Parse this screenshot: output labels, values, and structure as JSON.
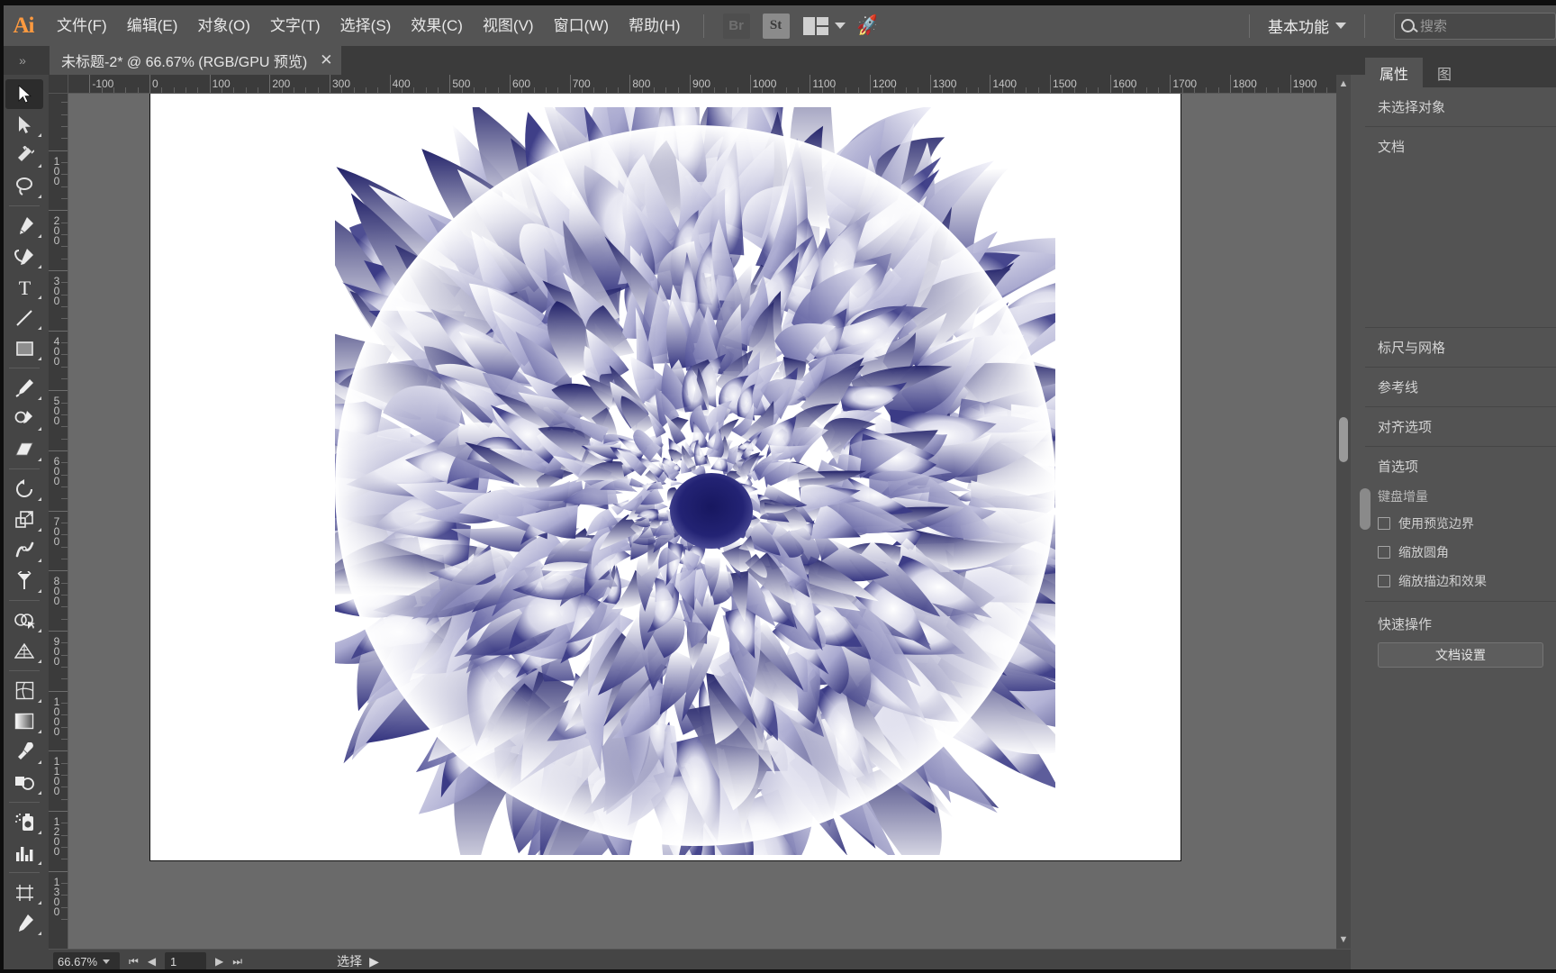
{
  "app": {
    "name": "Adobe Illustrator",
    "logo_text": "Ai",
    "accent_color": "#ff9a3f"
  },
  "menubar": {
    "items": [
      {
        "label": "文件(F)",
        "name": "file"
      },
      {
        "label": "编辑(E)",
        "name": "edit"
      },
      {
        "label": "对象(O)",
        "name": "object"
      },
      {
        "label": "文字(T)",
        "name": "type"
      },
      {
        "label": "选择(S)",
        "name": "select"
      },
      {
        "label": "效果(C)",
        "name": "effect"
      },
      {
        "label": "视图(V)",
        "name": "view"
      },
      {
        "label": "窗口(W)",
        "name": "window"
      },
      {
        "label": "帮助(H)",
        "name": "help"
      }
    ],
    "bridge_label": "Br",
    "stock_label": "St",
    "arrange_icon": "arrange-documents-icon",
    "rocket_icon": "discover-rocket-icon",
    "workspace_label": "基本功能",
    "workspace_chevron": "chevron-down-icon",
    "search_placeholder": "搜索",
    "search_value": "",
    "search_icon": "search-icon"
  },
  "tabbar": {
    "collapse_icon": "double-chevron-right-icon",
    "document_title": "未标题-2* @ 66.67% (RGB/GPU 预览)",
    "close_label": "✕"
  },
  "toolbar": {
    "tools": [
      {
        "name": "selection-tool",
        "label": "选择工具",
        "selected": true
      },
      {
        "name": "direct-selection-tool",
        "label": "直接选择工具",
        "selected": false
      },
      {
        "name": "magic-wand-tool",
        "label": "魔棒工具",
        "selected": false
      },
      {
        "name": "lasso-tool",
        "label": "套索工具",
        "selected": false
      },
      {
        "name": "pen-tool",
        "label": "钢笔工具",
        "selected": false
      },
      {
        "name": "curvature-tool",
        "label": "曲率工具",
        "selected": false
      },
      {
        "name": "type-tool",
        "label": "文字工具",
        "selected": false
      },
      {
        "name": "line-segment-tool",
        "label": "直线段工具",
        "selected": false
      },
      {
        "name": "rectangle-tool",
        "label": "矩形工具",
        "selected": false
      },
      {
        "name": "paintbrush-tool",
        "label": "画笔工具",
        "selected": false
      },
      {
        "name": "pencil-tool",
        "label": "铅笔工具",
        "selected": false
      },
      {
        "name": "eraser-tool",
        "label": "橡皮擦工具",
        "selected": false
      },
      {
        "name": "rotate-tool",
        "label": "旋转工具",
        "selected": false
      },
      {
        "name": "scale-tool",
        "label": "比例缩放工具",
        "selected": false
      },
      {
        "name": "width-tool",
        "label": "宽度工具",
        "selected": false
      },
      {
        "name": "free-transform-tool",
        "label": "自由变换工具",
        "selected": false
      },
      {
        "name": "shape-builder-tool",
        "label": "形状生成器工具",
        "selected": false
      },
      {
        "name": "perspective-grid-tool",
        "label": "透视网格工具",
        "selected": false
      },
      {
        "name": "mesh-tool",
        "label": "网格工具",
        "selected": false
      },
      {
        "name": "gradient-tool",
        "label": "渐变工具",
        "selected": false
      },
      {
        "name": "eyedropper-tool",
        "label": "吸管工具",
        "selected": false
      },
      {
        "name": "blend-tool",
        "label": "混合工具",
        "selected": false
      },
      {
        "name": "symbol-sprayer-tool",
        "label": "符号喷枪工具",
        "selected": false
      },
      {
        "name": "column-graph-tool",
        "label": "柱形图工具",
        "selected": false
      },
      {
        "name": "artboard-tool",
        "label": "画板工具",
        "selected": false
      },
      {
        "name": "slice-tool",
        "label": "切片工具",
        "selected": false
      }
    ]
  },
  "rulers": {
    "unit": "px",
    "h_labels": [
      "100",
      "0",
      "100",
      "200",
      "300",
      "400",
      "500",
      "600",
      "700",
      "800",
      "900",
      "1000",
      "1100",
      "1200",
      "1300",
      "1400"
    ],
    "h_first_negative": true,
    "v_labels": [
      "100",
      "200",
      "300",
      "400",
      "500",
      "600",
      "700",
      "800",
      "900"
    ]
  },
  "canvas": {
    "zoom": "66.67%",
    "artboard_background": "#ffffff",
    "pasteboard_color": "#6a6a6a",
    "artwork_name": "generative-dahlia-flower",
    "artwork_colors": {
      "deep": "#24246e",
      "mid": "#5b5b9e",
      "light": "#c8c8e2",
      "white": "#ffffff"
    }
  },
  "scrollbar": {
    "up_arrow": "chevron-up-icon",
    "down_arrow": "chevron-down-icon"
  },
  "properties_panel": {
    "tabs": [
      {
        "label": "属性",
        "name": "properties",
        "active": true
      },
      {
        "label": "图",
        "name": "libraries",
        "active": false
      }
    ],
    "no_selection": "未选择对象",
    "document_section": "文档",
    "rulers_grid_section": "标尺与网格",
    "guides_section": "参考线",
    "snap_section": "对齐选项",
    "preferences_section": "首选项",
    "keyboard_increment_label": "键盘增量",
    "checkboxes": [
      {
        "label": "使用预览边界",
        "checked": false,
        "name": "use-preview-bounds"
      },
      {
        "label": "缩放圆角",
        "checked": false,
        "name": "scale-corners"
      },
      {
        "label": "缩放描边和效果",
        "checked": false,
        "name": "scale-strokes-effects"
      }
    ],
    "quick_actions_label": "快速操作",
    "quick_action_button": "文档设置",
    "grip_icon": "panel-resize-grip"
  },
  "statusbar": {
    "zoom_value": "66.67%",
    "zoom_chevron": "chevron-down-icon",
    "first_page_icon": "first-page-icon",
    "prev_page_icon": "prev-page-icon",
    "page_value": "1",
    "next_page_icon": "next-page-icon",
    "last_page_icon": "last-page-icon",
    "status_text": "选择",
    "status_chevron": "chevron-right-icon"
  }
}
